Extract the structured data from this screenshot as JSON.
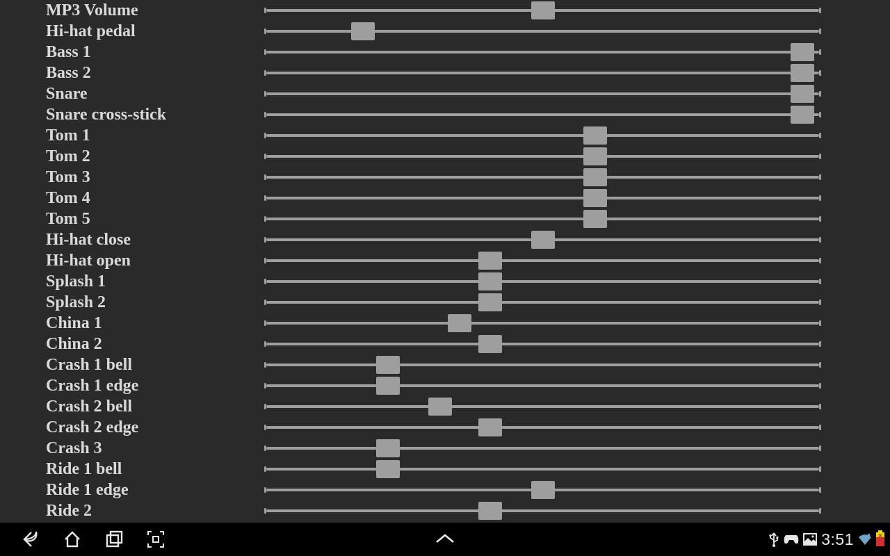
{
  "sliders": [
    {
      "label": "MP3 Volume",
      "value": 50
    },
    {
      "label": "Hi-hat pedal",
      "value": 17.5
    },
    {
      "label": "Bass 1",
      "value": 97
    },
    {
      "label": "Bass 2",
      "value": 97
    },
    {
      "label": "Snare",
      "value": 97
    },
    {
      "label": "Snare cross-stick",
      "value": 97
    },
    {
      "label": "Tom 1",
      "value": 59.5
    },
    {
      "label": "Tom 2",
      "value": 59.5
    },
    {
      "label": "Tom 3",
      "value": 59.5
    },
    {
      "label": "Tom 4",
      "value": 59.5
    },
    {
      "label": "Tom 5",
      "value": 59.5
    },
    {
      "label": "Hi-hat close",
      "value": 50
    },
    {
      "label": "Hi-hat open",
      "value": 40.5
    },
    {
      "label": "Splash 1",
      "value": 40.5
    },
    {
      "label": "Splash 2",
      "value": 40.5
    },
    {
      "label": "China 1",
      "value": 35
    },
    {
      "label": "China 2",
      "value": 40.5
    },
    {
      "label": "Crash 1 bell",
      "value": 22
    },
    {
      "label": "Crash 1 edge",
      "value": 22
    },
    {
      "label": "Crash 2 bell",
      "value": 31.5
    },
    {
      "label": "Crash 2 edge",
      "value": 40.5
    },
    {
      "label": "Crash 3",
      "value": 22
    },
    {
      "label": "Ride 1 bell",
      "value": 22
    },
    {
      "label": "Ride 1 edge",
      "value": 50
    },
    {
      "label": "Ride 2",
      "value": 40.5
    }
  ],
  "navbar": {
    "clock": "3:51"
  }
}
